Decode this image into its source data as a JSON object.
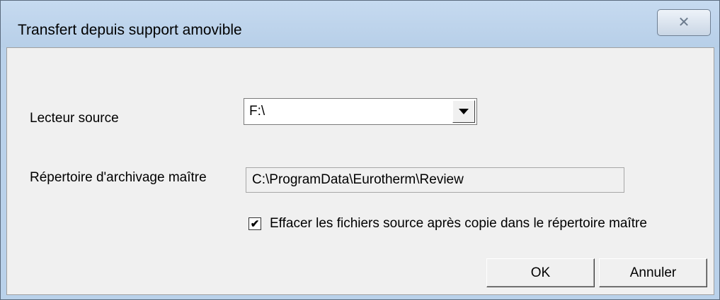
{
  "window": {
    "title": "Transfert depuis support amovible",
    "close_icon": "close-x-icon"
  },
  "form": {
    "source_drive_label": "Lecteur source",
    "source_drive_value": "F:\\",
    "master_dir_label": "Répertoire d'archivage maître",
    "master_dir_value": "C:\\ProgramData\\Eurotherm\\Review",
    "delete_checkbox_label": "Effacer les fichiers source après copie dans le répertoire maître",
    "delete_checkbox_checked": true
  },
  "buttons": {
    "ok_label": "OK",
    "cancel_label": "Annuler"
  }
}
